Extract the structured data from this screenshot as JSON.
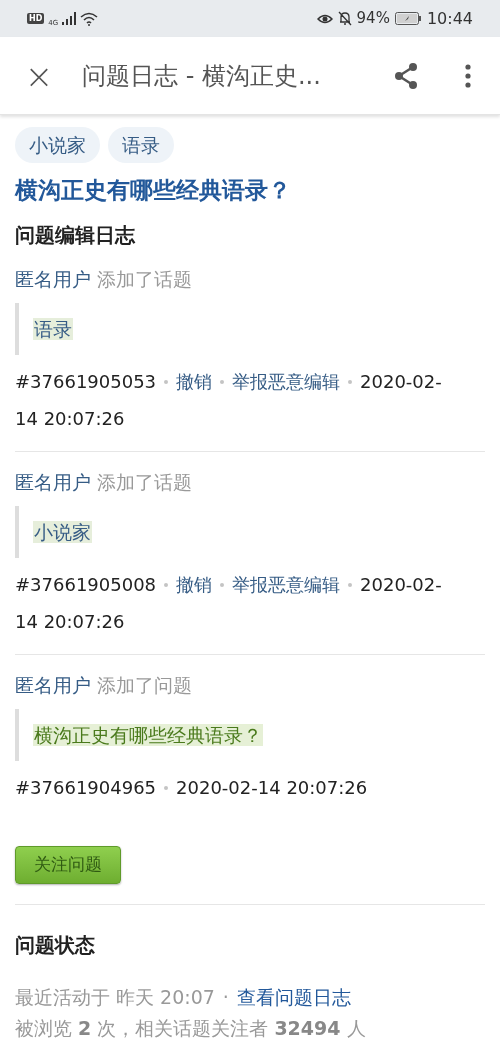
{
  "status_bar": {
    "hd": "HD",
    "network": "4G",
    "battery": "94%",
    "time": "10:44"
  },
  "app_bar": {
    "close": "×",
    "title": "问题日志 - 横沟正史..."
  },
  "topics": [
    {
      "label": "小说家"
    },
    {
      "label": "语录"
    }
  ],
  "question_title": "横沟正史有哪些经典语录？",
  "section_title": "问题编辑日志",
  "log_entries": [
    {
      "user": "匿名用户",
      "action": "添加了话题",
      "content": "语录",
      "kind": "topic",
      "id": "#37661905053",
      "links": [
        "撤销",
        "举报恶意编辑"
      ],
      "time_lines": [
        "2020-02-",
        "14 20:07:26"
      ]
    },
    {
      "user": "匿名用户",
      "action": "添加了话题",
      "content": "小说家",
      "kind": "topic",
      "id": "#37661905008",
      "links": [
        "撤销",
        "举报恶意编辑"
      ],
      "time_lines": [
        "2020-02-",
        "14 20:07:26"
      ]
    },
    {
      "user": "匿名用户",
      "action": "添加了问题",
      "content": "横沟正史有哪些经典语录？",
      "kind": "question",
      "id": "#37661904965",
      "time_lines": [
        "2020-02-14 20:07:26"
      ]
    }
  ],
  "follow_button": "关注问题",
  "status_section": {
    "title": "问题状态",
    "last_active": "最近活动于 昨天 20:07",
    "separator": "·",
    "log_link": "查看问题日志",
    "stats": "被浏览 **2** 次，相关话题关注者 **32494** 人"
  }
}
